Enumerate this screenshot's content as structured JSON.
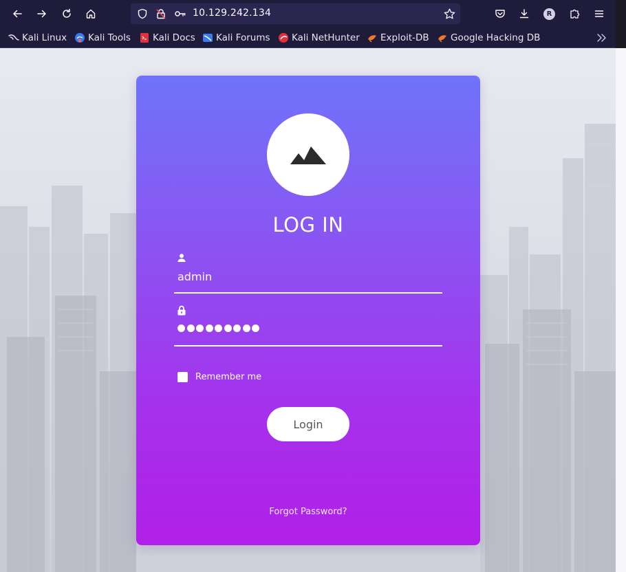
{
  "browser": {
    "url": "10.129.242.134",
    "profile_initial": "R",
    "bookmarks": [
      {
        "label": "Kali Linux",
        "icon": "kali-dragon-icon"
      },
      {
        "label": "Kali Tools",
        "icon": "kali-tools-icon"
      },
      {
        "label": "Kali Docs",
        "icon": "kali-docs-icon"
      },
      {
        "label": "Kali Forums",
        "icon": "kali-forums-icon"
      },
      {
        "label": "Kali NetHunter",
        "icon": "kali-nethunter-icon"
      },
      {
        "label": "Exploit-DB",
        "icon": "exploit-db-icon"
      },
      {
        "label": "Google Hacking DB",
        "icon": "ghdb-icon"
      }
    ],
    "colors": {
      "toolbar_bg": "#1f1b3a",
      "urlbar_bg": "#2b2650"
    }
  },
  "login": {
    "title": "LOG IN",
    "username": "admin",
    "password_mask_count": 9,
    "remember_label": "Remember me",
    "button_label": "Login",
    "forgot_label": "Forgot Password?",
    "colors": {
      "card_top": "#6f73fb",
      "card_bottom": "#b11fe8"
    }
  }
}
